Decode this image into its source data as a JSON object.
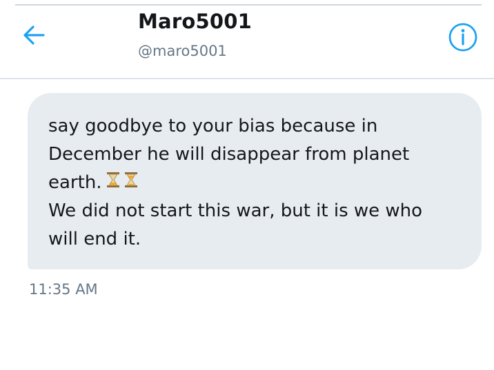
{
  "header": {
    "title": "Maro5001",
    "handle": "@maro5001",
    "back_icon": "arrow-left-icon",
    "info_icon": "info-circle-icon",
    "accent_color": "#1da1f2"
  },
  "message": {
    "lines": [
      "say goodbye to your bias because in",
      "December he will disappear from planet",
      "earth.",
      "We did not start this war, but it is we who",
      "will end it."
    ],
    "emojis": [
      "hourglass-icon",
      "hourglass-icon"
    ],
    "timestamp": "11:35 AM"
  },
  "colors": {
    "bubble": "#e7ecf0",
    "text": "#14171a",
    "secondary_text": "#657786"
  }
}
